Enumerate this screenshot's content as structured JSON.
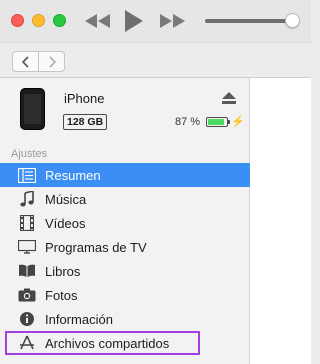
{
  "device": {
    "name": "iPhone",
    "capacity": "128 GB",
    "battery": "87 %",
    "battery_level": 0.87
  },
  "sidebar": {
    "section_label": "Ajustes",
    "items": [
      {
        "label": "Resumen",
        "icon": "summary-list-icon",
        "active": true
      },
      {
        "label": "Música",
        "icon": "music-note-icon"
      },
      {
        "label": "Vídeos",
        "icon": "film-strip-icon"
      },
      {
        "label": "Programas de TV",
        "icon": "tv-icon"
      },
      {
        "label": "Libros",
        "icon": "book-icon"
      },
      {
        "label": "Fotos",
        "icon": "camera-icon"
      },
      {
        "label": "Información",
        "icon": "info-icon"
      },
      {
        "label": "Archivos compartidos",
        "icon": "app-store-icon",
        "highlighted": true
      }
    ]
  },
  "colors": {
    "accent": "#3b8ef3",
    "highlight_outline": "#a53fe0",
    "battery": "#4cd964"
  }
}
